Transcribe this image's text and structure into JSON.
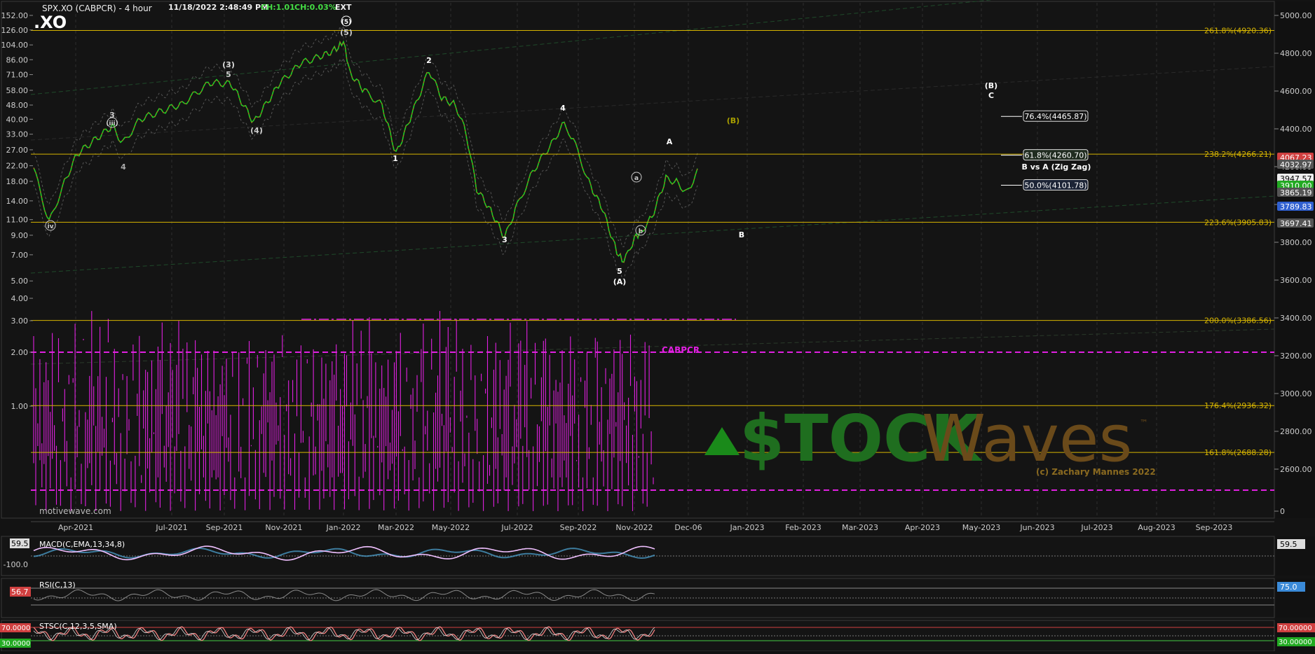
{
  "header": {
    "symbol": "SPX.XO (CABPCR) - 4 hour",
    "datetime": "11/18/2022 2:48:49 PM",
    "change": "CH:1.01",
    "change_pct": "CH:0.03%",
    "session": "EXT",
    "symbol_tag": ".XO"
  },
  "watermark": {
    "brand_left": "$TOCK",
    "brand_right": "Waves",
    "tm": "™",
    "copyright": "(c) Zachary Mannes 2022",
    "site": "motivewave.com"
  },
  "colors": {
    "background": "#131313",
    "fib": "#d6b400",
    "cabpcr": "#e020e0",
    "price_up": "#22cc22",
    "price_down": "#e04020",
    "macd": "#f0c0ff",
    "rsi": "#8a8a8a",
    "stoch": "#f08080"
  },
  "chart_data": [
    {
      "type": "line",
      "name": "main",
      "x_ticks": [
        "Apr-2021",
        "Jul-2021",
        "Sep-2021",
        "Nov-2021",
        "Jan-2022",
        "Mar-2022",
        "May-2022",
        "Jul-2022",
        "Sep-2022",
        "Nov-2022",
        "Dec-06",
        "Jan-2023",
        "Feb-2023",
        "Mar-2023",
        "Apr-2023",
        "May-2023",
        "Jun-2023",
        "Jul-2023",
        "Aug-2023",
        "Sep-2023"
      ],
      "right_axis_ticks": [
        "5000.00",
        "4800.00",
        "4600.00",
        "4400.00",
        "4200.00",
        "4000.00",
        "3800.00",
        "3600.00",
        "3400.00",
        "3200.00",
        "3000.00",
        "2800.00",
        "2600.00",
        "0"
      ],
      "left_axis_ticks": [
        "152.00",
        "126.00",
        "104.00",
        "86.00",
        "71.00",
        "58.00",
        "48.00",
        "40.00",
        "33.00",
        "27.00",
        "22.00",
        "18.00",
        "14.00",
        "11.00",
        "9.00",
        "7.00",
        "5.00",
        "4.00",
        "3.00",
        "2.00",
        "1.00"
      ],
      "right_price_labels": [
        "4067.23",
        "4032.97",
        "3947.57",
        "3910.00",
        "3865.19",
        "3789.83",
        "3697.41"
      ],
      "fib_levels": [
        {
          "label": "261.8%(4920.36)",
          "value": 4920.36
        },
        {
          "label": "238.2%(4266.21)",
          "value": 4266.21
        },
        {
          "label": "223.6%(3905.83)",
          "value": 3905.83
        },
        {
          "label": "200.0%(3386.56)",
          "value": 3386.56
        },
        {
          "label": "176.4%(2936.32)",
          "value": 2936.32
        },
        {
          "label": "161.8%(2688.28)",
          "value": 2688.28
        }
      ],
      "target_boxes": [
        {
          "label": "76.4%(4465.87)",
          "value": 4465.87
        },
        {
          "label": "61.8%(4260.70)",
          "value": 4260.7
        },
        {
          "label": "50.0%(4101.78)",
          "value": 4101.78
        }
      ],
      "target_note": "B vs A (Zig Zag)",
      "wave_labels": [
        "iv",
        "3",
        "(iii)",
        "4",
        "(3)",
        "5",
        "(4)",
        "(5)",
        "(5)",
        "1",
        "2",
        "3",
        "4",
        "5",
        "(A)",
        "a",
        "b",
        "A",
        "(B)",
        "B",
        "(B)",
        "C"
      ],
      "series": [
        {
          "name": "CABPCR",
          "values": [
            0.8,
            1.4,
            0.6,
            2.2,
            0.9,
            0.5,
            1.8,
            0.7,
            1.2,
            2.6,
            0.6,
            0.9,
            1.6,
            0.5,
            1.1,
            2.0,
            0.7,
            1.5,
            0.4,
            1.9,
            3.0,
            0.8,
            1.3,
            0.6,
            2.4,
            1.0,
            0.7,
            1.7,
            3.4,
            0.9,
            1.2,
            0.6,
            2.8,
            1.1,
            0.8,
            1.5,
            3.2,
            0.7,
            1.0,
            2.1,
            0.6,
            1.4
          ]
        }
      ],
      "cabpcr_label": "CABPCR",
      "cabpcr_level": 2.0
    },
    {
      "type": "line",
      "name": "MACD(C,EMA,13,34,8)",
      "left_ticks": [
        "59.5",
        "-100.0"
      ],
      "right_ticks": [
        "59.5"
      ]
    },
    {
      "type": "line",
      "name": "RSI(C,13)",
      "left_value": "56.7",
      "right_ticks": [
        "75.0"
      ]
    },
    {
      "type": "line",
      "name": "STSC(C,12,3,5,SMA)",
      "left_ticks": [
        "70.0000",
        "30.0000"
      ],
      "right_ticks": [
        "70.00000",
        "30.00000"
      ]
    }
  ]
}
